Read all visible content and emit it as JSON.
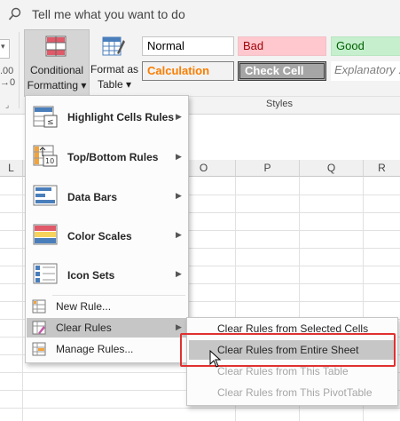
{
  "ribbon": {
    "tell_me": "Tell me what you want to do",
    "edge_text_1": ".00",
    "edge_text_2": "→0",
    "conditional_formatting_l1": "Conditional",
    "conditional_formatting_l2": "Formatting ▾",
    "format_as_table_l1": "Format as",
    "format_as_table_l2": "Table ▾",
    "styles_group_label": "Styles",
    "styles": {
      "normal": "Normal",
      "bad": "Bad",
      "good": "Good",
      "calculation": "Calculation",
      "check_cell": "Check Cell",
      "explanatory": "Explanatory ..."
    }
  },
  "sheet": {
    "columns": [
      "L",
      "O",
      "P",
      "Q",
      "R"
    ]
  },
  "menu": {
    "highlight": "Highlight Cells Rules",
    "top_bottom": "Top/Bottom Rules",
    "data_bars": "Data Bars",
    "color_scales": "Color Scales",
    "icon_sets": "Icon Sets",
    "new_rule": "New Rule...",
    "clear_rules": "Clear Rules",
    "manage_rules": "Manage Rules..."
  },
  "submenu": {
    "selected_cells": "Clear Rules from Selected Cells",
    "entire_sheet": "Clear Rules from Entire Sheet",
    "this_table": "Clear Rules from This Table",
    "pivot_table": "Clear Rules from This PivotTable"
  },
  "colors": {
    "accent_red": "#e03030",
    "hover_gray": "#c6c6c6"
  }
}
